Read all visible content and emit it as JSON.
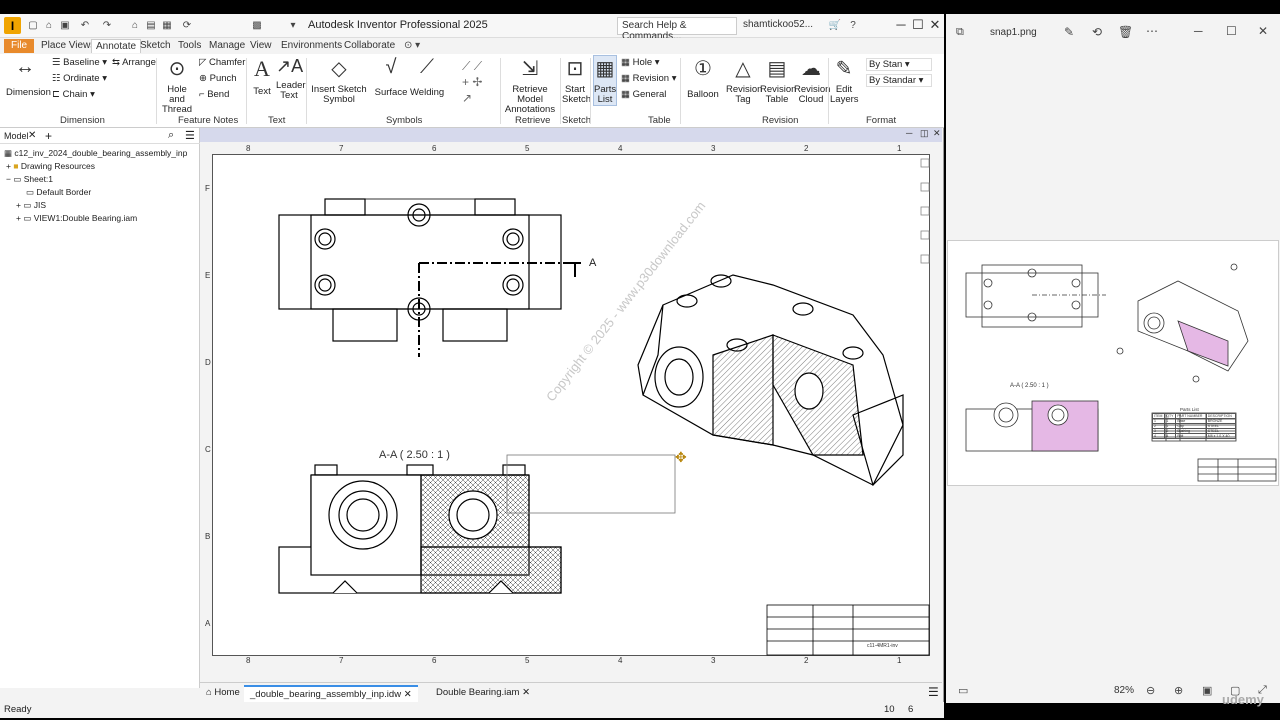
{
  "inventor": {
    "logo_letter": "I",
    "title": "Autodesk Inventor Professional 2025",
    "search_placeholder": "Search Help & Commands...",
    "user": "shamtickoo52...",
    "tabs": [
      "File",
      "Place Views",
      "Annotate",
      "Sketch",
      "Tools",
      "Manage",
      "View",
      "Environments",
      "Collaborate"
    ],
    "active_tab": "Annotate",
    "ribbon": {
      "dimension": {
        "big": "Dimension",
        "baseline": "Baseline",
        "ordinate": "Ordinate",
        "chain": "Chain",
        "arrange": "Arrange",
        "group": "Dimension"
      },
      "feature_notes": {
        "hole_thread": "Hole and Thread",
        "chamfer": "Chamfer",
        "punch": "Punch",
        "bend": "Bend",
        "group": "Feature Notes"
      },
      "text": {
        "text": "Text",
        "leader": "Leader Text",
        "group": "Text"
      },
      "symbols": {
        "insert": "Insert Sketch Symbol",
        "surface": "Surface",
        "welding": "Welding",
        "group": "Symbols"
      },
      "retrieve": {
        "retrieve": "Retrieve Model Annotations",
        "group": "Retrieve"
      },
      "sketch": {
        "start": "Start Sketch",
        "group": "Sketch"
      },
      "table": {
        "parts": "Parts List",
        "hole": "Hole",
        "revision": "Revision",
        "general": "General",
        "group": "Table"
      },
      "revision": {
        "balloon": "Balloon",
        "rev_tag": "Revision Tag",
        "rev_table": "Revision Table",
        "rev_cloud": "Revision Cloud",
        "group": "Revision"
      },
      "format": {
        "edit_layers": "Edit Layers",
        "by_stan1": "By Stan",
        "by_stan2": "By Standar",
        "group": "Format"
      }
    },
    "browser": {
      "tab": "Model",
      "root": "c12_inv_2024_double_bearing_assembly_inp",
      "items": [
        "Drawing Resources",
        "Sheet:1",
        "Default Border",
        "JIS",
        "VIEW1:Double Bearing.iam"
      ]
    },
    "drawing": {
      "top_ruler": [
        "8",
        "7",
        "6",
        "5",
        "4",
        "3",
        "2",
        "1"
      ],
      "side_ruler": [
        "F",
        "E",
        "D",
        "C",
        "B",
        "A"
      ],
      "section_label": "A-A  ( 2.50 : 1 )",
      "section_arrow": "A",
      "watermark": "Copyright © 2025 - www.p30download.com",
      "title_block_text": "c11-4MR1-inv"
    },
    "doc_tabs": [
      "Home",
      "_double_bearing_assembly_inp.idw",
      "Double Bearing.iam"
    ],
    "status": {
      "ready": "Ready",
      "n1": "10",
      "n2": "6"
    }
  },
  "photos": {
    "filename": "snap1.png",
    "zoom": "82%",
    "section_label": "A-A ( 2.50 : 1 )",
    "parts_list_title": "Parts List",
    "parts_header": [
      "ITEM",
      "QTY",
      "PART NUMBER",
      "DESCRIPTION"
    ],
    "parts_rows": [
      [
        "1",
        "1",
        "Base",
        "BRONZE"
      ],
      [
        "2",
        "1",
        "Cap",
        "STEEL"
      ],
      [
        "3",
        "2",
        "Bushing",
        "STEEL"
      ],
      [
        "4",
        "4",
        "Bolt",
        "M6 x 1.0 X 40"
      ]
    ]
  },
  "watermark": "udemy"
}
